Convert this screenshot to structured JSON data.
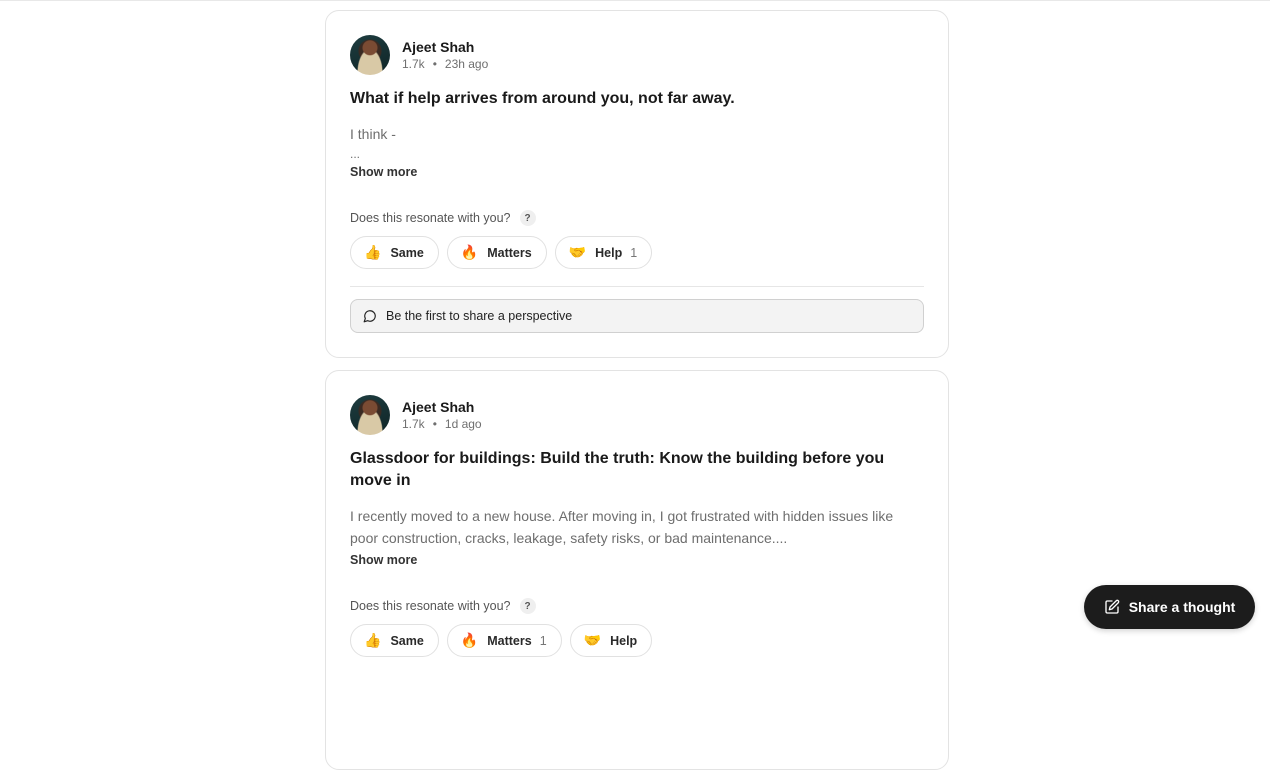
{
  "posts": [
    {
      "author": {
        "name": "Ajeet Shah",
        "followers": "1.7k",
        "separator": "•",
        "time": "23h ago"
      },
      "title": "What if help arrives from around you, not far away.",
      "excerpt": "I think -",
      "excerpt_ellipsis": "...",
      "show_more": "Show more",
      "resonate_label": "Does this resonate with you?",
      "help_tip": "?",
      "reactions": [
        {
          "emoji": "👍",
          "label": "Same",
          "count": ""
        },
        {
          "emoji": "🔥",
          "label": "Matters",
          "count": ""
        },
        {
          "emoji": "🤝",
          "label": "Help",
          "count": "1"
        }
      ],
      "perspective_prompt": "Be the first to share a perspective"
    },
    {
      "author": {
        "name": "Ajeet Shah",
        "followers": "1.7k",
        "separator": "•",
        "time": "1d ago"
      },
      "title": "Glassdoor for buildings: Build the truth: Know the building before you move in",
      "excerpt": "I recently moved to a new house. After moving in, I got frustrated with hidden issues like poor construction, cracks, leakage, safety risks, or bad maintenance....",
      "show_more": "Show more",
      "resonate_label": "Does this resonate with you?",
      "help_tip": "?",
      "reactions": [
        {
          "emoji": "👍",
          "label": "Same",
          "count": ""
        },
        {
          "emoji": "🔥",
          "label": "Matters",
          "count": "1"
        },
        {
          "emoji": "🤝",
          "label": "Help",
          "count": ""
        }
      ]
    }
  ],
  "fab": {
    "label": "Share a thought",
    "icon": "edit-icon"
  }
}
